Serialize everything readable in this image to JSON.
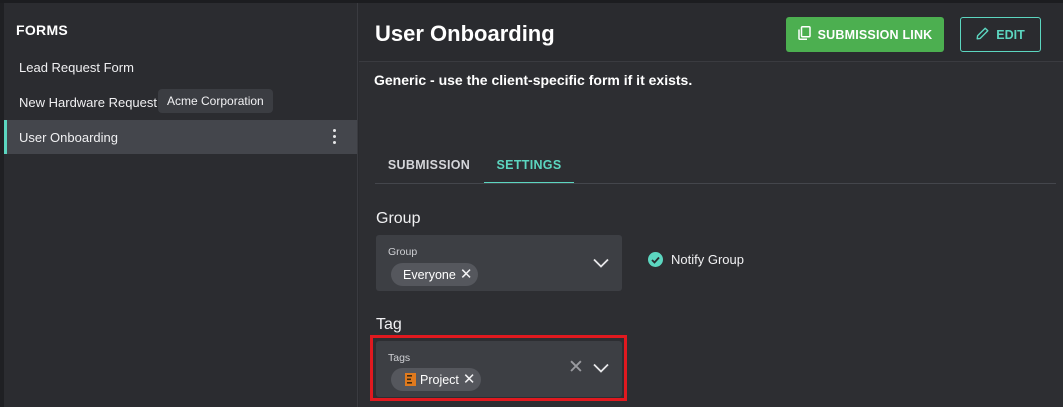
{
  "sidebar": {
    "title": "FORMS",
    "items": [
      {
        "label": "Lead Request Form"
      },
      {
        "label": "New Hardware Request"
      },
      {
        "label": "User Onboarding"
      }
    ],
    "tooltip": "Acme Corporation"
  },
  "header": {
    "title": "User Onboarding",
    "submission_link_label": "SUBMISSION LINK",
    "edit_label": "EDIT"
  },
  "main": {
    "description": "Generic - use the client-specific form if it exists.",
    "tabs": [
      {
        "label": "SUBMISSION",
        "active": false
      },
      {
        "label": "SETTINGS",
        "active": true
      }
    ],
    "group": {
      "section_label": "Group",
      "field_label": "Group",
      "chips": [
        "Everyone"
      ],
      "notify_label": "Notify Group"
    },
    "tag": {
      "section_label": "Tag",
      "field_label": "Tags",
      "chips": [
        "Project"
      ]
    }
  },
  "colors": {
    "accent": "#5cd6c0",
    "primary_button": "#4caf50",
    "highlight": "#e0191f"
  },
  "icons": [
    "copy-icon",
    "pencil-icon",
    "chevron-down-icon",
    "close-icon",
    "check-circle-icon",
    "kebab-icon",
    "tag-icon"
  ]
}
